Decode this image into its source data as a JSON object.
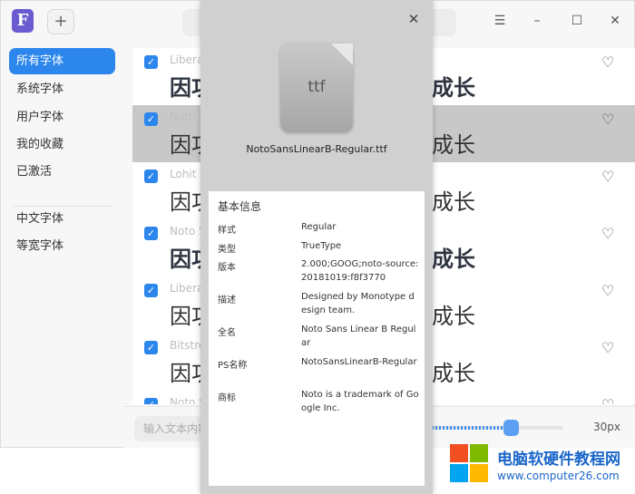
{
  "app": {
    "logo_letter": "F",
    "add_symbol": "+"
  },
  "window_controls": {
    "menu": "☰",
    "minimize": "–",
    "maximize": "☐",
    "close": "✕"
  },
  "sidebar": {
    "items": [
      {
        "label": "所有字体",
        "active": true
      },
      {
        "label": "系统字体",
        "active": false
      },
      {
        "label": "用户字体",
        "active": false
      },
      {
        "label": "我的收藏",
        "active": false
      },
      {
        "label": "已激活",
        "active": false
      },
      {
        "label": "中文字体",
        "active": false
      },
      {
        "label": "等宽字体",
        "active": false
      }
    ]
  },
  "font_list": [
    {
      "name": "Libera",
      "preview_left": "因功",
      "preview_right": "成长",
      "bold": true,
      "selected": false,
      "checked": true
    },
    {
      "name": "Noto",
      "preview_left": "因功",
      "preview_right": "成长",
      "bold": false,
      "selected": true,
      "checked": true
    },
    {
      "name": "Lohit L",
      "preview_left": "因功",
      "preview_right": "成长",
      "bold": false,
      "selected": false,
      "checked": true
    },
    {
      "name": "Noto S",
      "preview_left": "因功",
      "preview_right": "成长",
      "bold": true,
      "selected": false,
      "checked": true
    },
    {
      "name": "Libera",
      "preview_left": "因功",
      "preview_right": "成长",
      "bold": false,
      "selected": false,
      "checked": true
    },
    {
      "name": "Bitstre",
      "preview_left": "因功",
      "preview_right": "成长",
      "bold": false,
      "selected": false,
      "checked": true
    },
    {
      "name": "Noto S",
      "preview_left": "",
      "preview_right": "",
      "bold": false,
      "selected": false,
      "checked": true
    }
  ],
  "bottom": {
    "input_placeholder": "输入文本内容",
    "font_size_label": "30px",
    "font_size_fraction": 0.6
  },
  "dialog": {
    "close": "✕",
    "file_ext": "ttf",
    "file_name": "NotoSansLinearB-Regular.ttf",
    "info_title": "基本信息",
    "fields": [
      {
        "label": "样式",
        "value": "Regular"
      },
      {
        "label": "类型",
        "value": "TrueType"
      },
      {
        "label": "版本",
        "value": "2.000;GOOG;noto-source:20181019:f8f3770"
      },
      {
        "label": "描述",
        "value": "Designed by Monotype design team."
      },
      {
        "label": "全名",
        "value": "Noto Sans Linear B Regular"
      },
      {
        "label": "PS名称",
        "value": "NotoSansLinearB-Regular"
      },
      {
        "label": "商标",
        "value": "Noto is a trademark of Google Inc."
      }
    ]
  },
  "watermark": {
    "title": "电脑软硬件教程网",
    "url": "www.computer26.com"
  },
  "colors": {
    "accent": "#2c86ec",
    "selected_row": "#c8c8c8",
    "dialog_bg": "#d0d0d0"
  }
}
